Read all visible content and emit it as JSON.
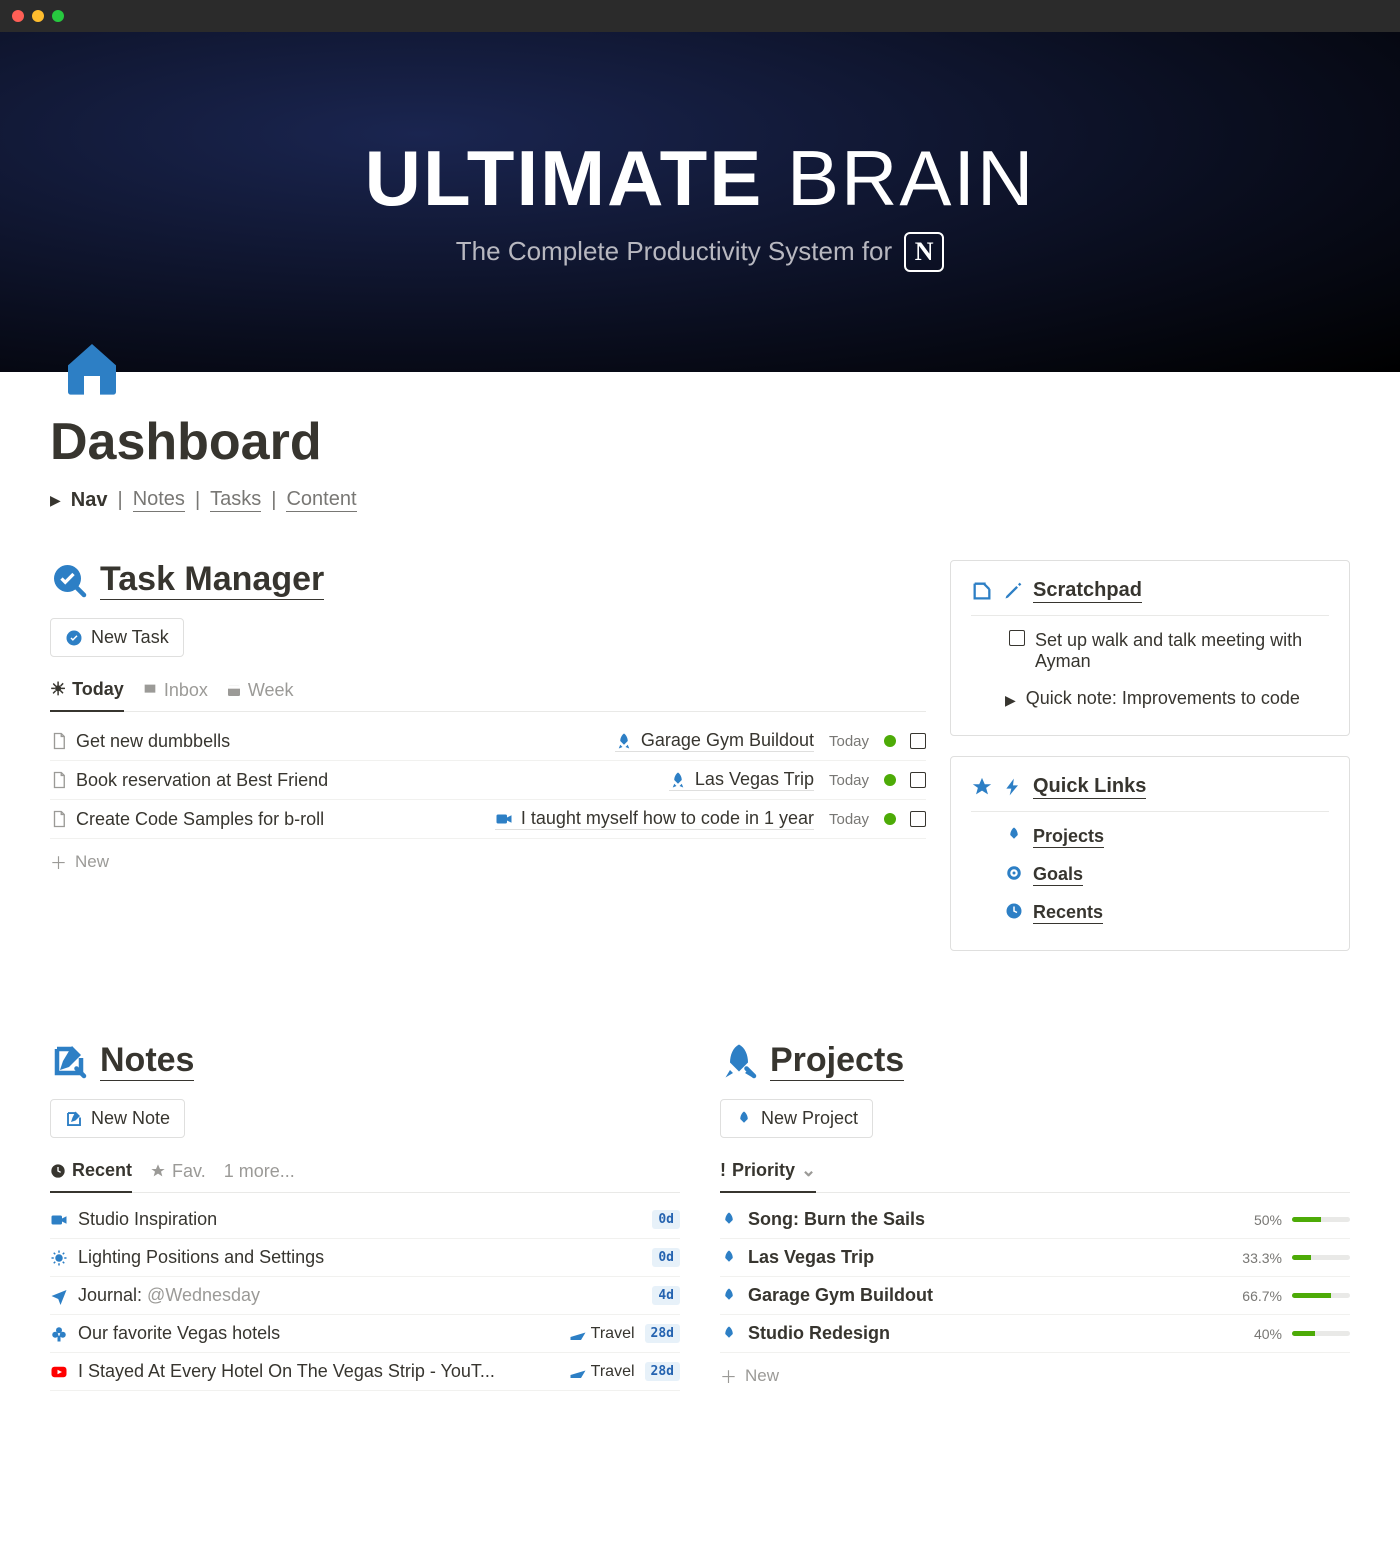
{
  "hero": {
    "title_bold": "ULTIMATE",
    "title_light": "BRAIN",
    "subtitle": "The Complete Productivity System for"
  },
  "page_title": "Dashboard",
  "breadcrumb": {
    "nav": "Nav",
    "notes": "Notes",
    "tasks": "Tasks",
    "content": "Content"
  },
  "task_manager": {
    "heading": "Task Manager",
    "new_task": "New Task",
    "tabs": {
      "today": "Today",
      "inbox": "Inbox",
      "week": "Week"
    },
    "rows": [
      {
        "title": "Get new dumbbells",
        "context": "Garage Gym Buildout",
        "context_type": "rocket",
        "date": "Today"
      },
      {
        "title": "Book reservation at Best Friend",
        "context": "Las Vegas Trip",
        "context_type": "rocket",
        "date": "Today"
      },
      {
        "title": "Create Code Samples for b-roll",
        "context": "I taught myself how to code in 1 year",
        "context_type": "video",
        "date": "Today"
      }
    ],
    "new_label": "New"
  },
  "scratchpad": {
    "heading": "Scratchpad",
    "items": [
      {
        "type": "checkbox",
        "text": "Set up walk and talk meeting with Ayman"
      },
      {
        "type": "toggle",
        "text": "Quick note: Improvements to code"
      }
    ]
  },
  "quick_links": {
    "heading": "Quick Links",
    "items": [
      {
        "icon": "rocket",
        "text": "Projects"
      },
      {
        "icon": "target",
        "text": "Goals"
      },
      {
        "icon": "clock",
        "text": "Recents"
      }
    ]
  },
  "notes": {
    "heading": "Notes",
    "new_note": "New Note",
    "tabs": {
      "recent": "Recent",
      "fav": "Fav.",
      "more": "1 more..."
    },
    "rows": [
      {
        "icon": "video",
        "title": "Studio Inspiration",
        "tag": "",
        "age": "0d"
      },
      {
        "icon": "sun",
        "title": "Lighting Positions and Settings",
        "tag": "",
        "age": "0d"
      },
      {
        "icon": "plane-up",
        "title_prefix": "Journal: ",
        "title_muted": "@Wednesday",
        "tag": "",
        "age": "4d"
      },
      {
        "icon": "club",
        "title": "Our favorite Vegas hotels",
        "tag": "Travel",
        "age": "28d"
      },
      {
        "icon": "youtube",
        "title": "I Stayed At Every Hotel On The Vegas Strip - YouT...",
        "tag": "Travel",
        "age": "28d"
      }
    ]
  },
  "projects": {
    "heading": "Projects",
    "new_project": "New Project",
    "tab": "Priority",
    "rows": [
      {
        "title": "Song: Burn the Sails",
        "pct": "50%",
        "pct_val": 50
      },
      {
        "title": "Las Vegas Trip",
        "pct": "33.3%",
        "pct_val": 33.3
      },
      {
        "title": "Garage Gym Buildout",
        "pct": "66.7%",
        "pct_val": 66.7
      },
      {
        "title": "Studio Redesign",
        "pct": "40%",
        "pct_val": 40
      }
    ],
    "new_label": "New"
  }
}
